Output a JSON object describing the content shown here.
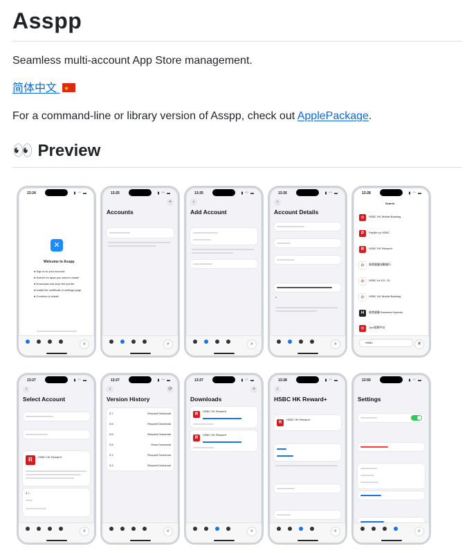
{
  "title": "Asspp",
  "tagline": "Seamless multi-account App Store management.",
  "lang_link": "简体中文",
  "cli_text_before": "For a command-line or library version of Asspp, check out ",
  "cli_link": "ApplePackage",
  "cli_text_after": ".",
  "preview_heading": "👀 Preview",
  "screens": [
    {
      "time": "13:24",
      "title": "Welcome to Asspp"
    },
    {
      "time": "13:25",
      "title": "Accounts"
    },
    {
      "time": "13:25",
      "title": "Add Account"
    },
    {
      "time": "13:26",
      "title": "Account Details"
    },
    {
      "time": "13:28",
      "title": "Search"
    },
    {
      "time": "13:27",
      "title": "Select Account"
    },
    {
      "time": "13:27",
      "title": "Version History"
    },
    {
      "time": "13:27",
      "title": "Downloads"
    },
    {
      "time": "13:28",
      "title": "HSBC HK Reward+"
    },
    {
      "time": "13:50",
      "title": "Settings"
    }
  ],
  "welcome_items": [
    "Sign in to your account.",
    "Search for apps you want to install.",
    "Download and save the ipa file.",
    "Install the certificate in settings page.",
    "Continue to install."
  ],
  "search_results": [
    "HSBC HK Mobile Banking",
    "PayMe by HSBC",
    "HSBC HK Reward+",
    "香港滙豐流動銀行",
    "HSBC for EG, SL",
    "HSBC UK Mobile Banking",
    "香港滙豐 Business Express",
    "Job/招聘平台"
  ],
  "version_rows": [
    {
      "ver": "3.7",
      "action": "Request Download"
    },
    {
      "ver": "3.6",
      "action": "Request Download"
    },
    {
      "ver": "3.6",
      "action": "Request Download"
    },
    {
      "ver": "3.5",
      "action": "Show Download"
    },
    {
      "ver": "3.4",
      "action": "Request Download"
    },
    {
      "ver": "3.3",
      "action": "Request Download"
    }
  ],
  "tab_labels": [
    "Home",
    "Accounts",
    "Downloads",
    "Settings"
  ],
  "search_query": "HSBC"
}
